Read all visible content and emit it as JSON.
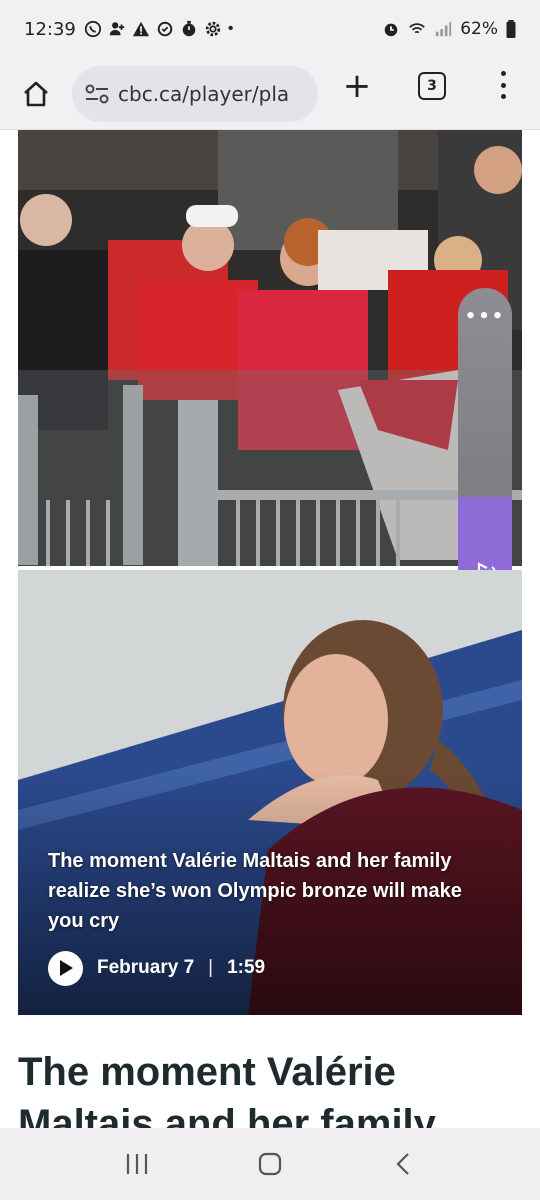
{
  "status_bar": {
    "time": "12:39",
    "battery": "62%",
    "dot": "•"
  },
  "browser": {
    "url": "cbc.ca/player/pla",
    "tab_count": "3",
    "new_tab_label": "+"
  },
  "audio_widget": {
    "more_label": "•••",
    "level": 0.33,
    "accent_color": "#8e6bd6"
  },
  "video": {
    "caption": "The moment Valérie Maltais and her family realize she’s won Olympic bronze will make you cry",
    "date": "February 7",
    "separator": "|",
    "duration": "1:59"
  },
  "article": {
    "headline_visible": "The moment Valérie Maltais and her family"
  },
  "icons": {
    "home": "home-icon",
    "site_settings": "tune-icon",
    "menu": "more-vert-icon",
    "play": "play-icon",
    "audio": "music-note-icon",
    "nav_recents": "recents-icon",
    "nav_home": "home-circle-icon",
    "nav_back": "back-icon"
  }
}
